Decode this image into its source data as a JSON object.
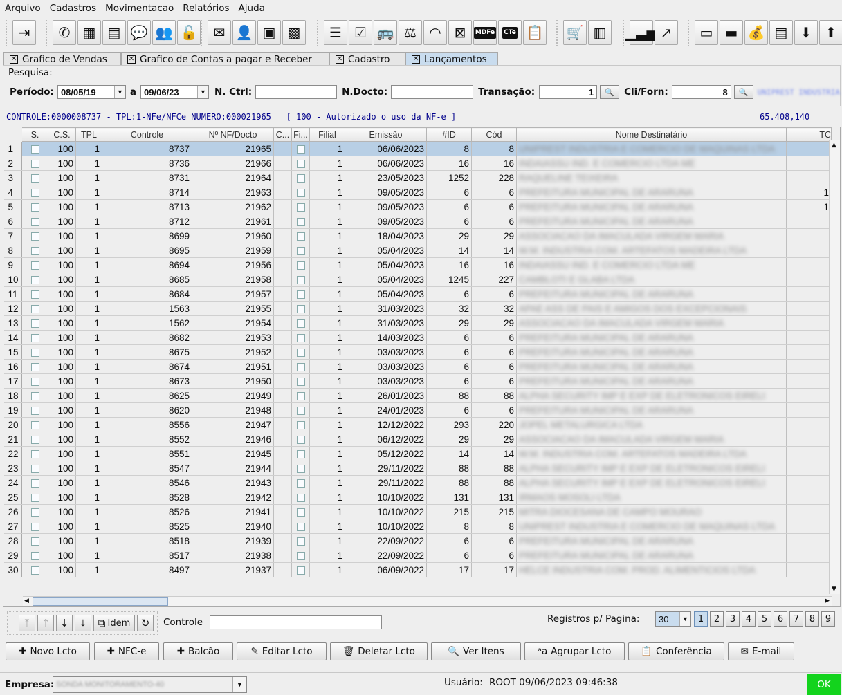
{
  "menu": [
    "Arquivo",
    "Cadastros",
    "Movimentacao",
    "Relatórios",
    "Ajuda"
  ],
  "toolbar_icons": {
    "g1": [
      "exit-icon"
    ],
    "g2": [
      "whatsapp-icon",
      "calculator-icon",
      "document-icon",
      "chat-icon",
      "users-group-icon",
      "lock-icon"
    ],
    "g3": [
      "mail-icon",
      "user-admin-icon",
      "package-icon",
      "calculator-dark-icon"
    ],
    "g4": [
      "list-icon",
      "checklist-icon",
      "bus-icon",
      "scale-icon",
      "rss-icon",
      "close-box-icon",
      "mdfe-icon",
      "cte-icon",
      "clipboard-check-icon"
    ],
    "g5": [
      "shopping-cart-icon",
      "cash-register-icon"
    ],
    "g6": [
      "bar-chart-icon",
      "trend-chart-icon"
    ],
    "g7": [
      "id-card-icon",
      "money-icon",
      "money-bag-icon",
      "invoice-icon",
      "box-down-icon",
      "box-up-icon"
    ]
  },
  "mdfe_label": "MDFe",
  "cte_label": "CTe",
  "tabs": [
    "Grafico de Vendas",
    "Grafico de Contas a pagar e Receber",
    "Cadastro",
    "Lançamentos"
  ],
  "search": {
    "title": "Pesquisa:",
    "periodo_label": "Período:",
    "date_from": "08/05/19",
    "a_label": "a",
    "date_to": "09/06/23",
    "nctrl_label": "N. Ctrl:",
    "nctrl_value": "",
    "ndocto_label": "N.Docto:",
    "ndocto_value": "",
    "transacao_label": "Transação:",
    "transacao_value": "1",
    "cliforn_label": "Cli/Forn:",
    "cliforn_value": "8",
    "cliforn_name": "UNIPREST INDUSTRIA"
  },
  "status_line": "CONTROLE:0000008737 - TPL:1-NFe/NFCe NUMERO:000021965   [ 100 - Autorizado o uso da NF-e ]",
  "status_total": "65.408,140",
  "columns": [
    "S.",
    "C.S.",
    "TPL",
    "Controle",
    "Nº NF/Docto",
    "C...",
    "Fi...",
    "Filial",
    "Emissão",
    "#ID",
    "Cód",
    "Nome Destinatário",
    "TC"
  ],
  "rows": [
    {
      "n": "1",
      "cs": "100",
      "tpl": "1",
      "ctrl": "8737",
      "nf": "21965",
      "filial": "1",
      "emissao": "06/06/2023",
      "id": "8",
      "cod": "8",
      "nome": "UNIPREST INDUSTRIA E COMERCIO DE MAQUINAS LTDA",
      "tc": ""
    },
    {
      "n": "2",
      "cs": "100",
      "tpl": "1",
      "ctrl": "8736",
      "nf": "21966",
      "filial": "1",
      "emissao": "06/06/2023",
      "id": "16",
      "cod": "16",
      "nome": "INDAIASSU IND. E COMERCIO LTDA ME",
      "tc": ""
    },
    {
      "n": "3",
      "cs": "100",
      "tpl": "1",
      "ctrl": "8731",
      "nf": "21964",
      "filial": "1",
      "emissao": "23/05/2023",
      "id": "1252",
      "cod": "228",
      "nome": "RAQUELINE TEIXEIRA",
      "tc": ""
    },
    {
      "n": "4",
      "cs": "100",
      "tpl": "1",
      "ctrl": "8714",
      "nf": "21963",
      "filial": "1",
      "emissao": "09/05/2023",
      "id": "6",
      "cod": "6",
      "nome": "PREFEITURA MUNICIPAL DE ARARUNA",
      "tc": "1"
    },
    {
      "n": "5",
      "cs": "100",
      "tpl": "1",
      "ctrl": "8713",
      "nf": "21962",
      "filial": "1",
      "emissao": "09/05/2023",
      "id": "6",
      "cod": "6",
      "nome": "PREFEITURA MUNICIPAL DE ARARUNA",
      "tc": "1"
    },
    {
      "n": "6",
      "cs": "100",
      "tpl": "1",
      "ctrl": "8712",
      "nf": "21961",
      "filial": "1",
      "emissao": "09/05/2023",
      "id": "6",
      "cod": "6",
      "nome": "PREFEITURA MUNICIPAL DE ARARUNA",
      "tc": ""
    },
    {
      "n": "7",
      "cs": "100",
      "tpl": "1",
      "ctrl": "8699",
      "nf": "21960",
      "filial": "1",
      "emissao": "18/04/2023",
      "id": "29",
      "cod": "29",
      "nome": "ASSOCIACAO DA IMACULADA VIRGEM MARIA",
      "tc": ""
    },
    {
      "n": "8",
      "cs": "100",
      "tpl": "1",
      "ctrl": "8695",
      "nf": "21959",
      "filial": "1",
      "emissao": "05/04/2023",
      "id": "14",
      "cod": "14",
      "nome": "W.M. INDUSTRIA COM. ARTEFATOS MADEIRA LTDA",
      "tc": ""
    },
    {
      "n": "9",
      "cs": "100",
      "tpl": "1",
      "ctrl": "8694",
      "nf": "21956",
      "filial": "1",
      "emissao": "05/04/2023",
      "id": "16",
      "cod": "16",
      "nome": "INDAIASSU IND. E COMERCIO LTDA ME",
      "tc": ""
    },
    {
      "n": "10",
      "cs": "100",
      "tpl": "1",
      "ctrl": "8685",
      "nf": "21958",
      "filial": "1",
      "emissao": "05/04/2023",
      "id": "1245",
      "cod": "227",
      "nome": "CAMBLOTI E GLABA LTDA",
      "tc": ""
    },
    {
      "n": "11",
      "cs": "100",
      "tpl": "1",
      "ctrl": "8684",
      "nf": "21957",
      "filial": "1",
      "emissao": "05/04/2023",
      "id": "6",
      "cod": "6",
      "nome": "PREFEITURA MUNICIPAL DE ARARUNA",
      "tc": ""
    },
    {
      "n": "12",
      "cs": "100",
      "tpl": "1",
      "ctrl": "1563",
      "nf": "21955",
      "filial": "1",
      "emissao": "31/03/2023",
      "id": "32",
      "cod": "32",
      "nome": "APAE ASS DE PAIS E AMIGOS DOS EXCEPCIONAIS",
      "tc": ""
    },
    {
      "n": "13",
      "cs": "100",
      "tpl": "1",
      "ctrl": "1562",
      "nf": "21954",
      "filial": "1",
      "emissao": "31/03/2023",
      "id": "29",
      "cod": "29",
      "nome": "ASSOCIACAO DA IMACULADA VIRGEM MARIA",
      "tc": ""
    },
    {
      "n": "14",
      "cs": "100",
      "tpl": "1",
      "ctrl": "8682",
      "nf": "21953",
      "filial": "1",
      "emissao": "14/03/2023",
      "id": "6",
      "cod": "6",
      "nome": "PREFEITURA MUNICIPAL DE ARARUNA",
      "tc": ""
    },
    {
      "n": "15",
      "cs": "100",
      "tpl": "1",
      "ctrl": "8675",
      "nf": "21952",
      "filial": "1",
      "emissao": "03/03/2023",
      "id": "6",
      "cod": "6",
      "nome": "PREFEITURA MUNICIPAL DE ARARUNA",
      "tc": ""
    },
    {
      "n": "16",
      "cs": "100",
      "tpl": "1",
      "ctrl": "8674",
      "nf": "21951",
      "filial": "1",
      "emissao": "03/03/2023",
      "id": "6",
      "cod": "6",
      "nome": "PREFEITURA MUNICIPAL DE ARARUNA",
      "tc": ""
    },
    {
      "n": "17",
      "cs": "100",
      "tpl": "1",
      "ctrl": "8673",
      "nf": "21950",
      "filial": "1",
      "emissao": "03/03/2023",
      "id": "6",
      "cod": "6",
      "nome": "PREFEITURA MUNICIPAL DE ARARUNA",
      "tc": ""
    },
    {
      "n": "18",
      "cs": "100",
      "tpl": "1",
      "ctrl": "8625",
      "nf": "21949",
      "filial": "1",
      "emissao": "26/01/2023",
      "id": "88",
      "cod": "88",
      "nome": "ALPHA SECURITY IMP E EXP DE ELETRONICOS EIRELI",
      "tc": ""
    },
    {
      "n": "19",
      "cs": "100",
      "tpl": "1",
      "ctrl": "8620",
      "nf": "21948",
      "filial": "1",
      "emissao": "24/01/2023",
      "id": "6",
      "cod": "6",
      "nome": "PREFEITURA MUNICIPAL DE ARARUNA",
      "tc": ""
    },
    {
      "n": "20",
      "cs": "100",
      "tpl": "1",
      "ctrl": "8556",
      "nf": "21947",
      "filial": "1",
      "emissao": "12/12/2022",
      "id": "293",
      "cod": "220",
      "nome": "JOPEL METALURGICA LTDA",
      "tc": ""
    },
    {
      "n": "21",
      "cs": "100",
      "tpl": "1",
      "ctrl": "8552",
      "nf": "21946",
      "filial": "1",
      "emissao": "06/12/2022",
      "id": "29",
      "cod": "29",
      "nome": "ASSOCIACAO DA IMACULADA VIRGEM MARIA",
      "tc": ""
    },
    {
      "n": "22",
      "cs": "100",
      "tpl": "1",
      "ctrl": "8551",
      "nf": "21945",
      "filial": "1",
      "emissao": "05/12/2022",
      "id": "14",
      "cod": "14",
      "nome": "W.M. INDUSTRIA COM. ARTEFATOS MADEIRA LTDA",
      "tc": ""
    },
    {
      "n": "23",
      "cs": "100",
      "tpl": "1",
      "ctrl": "8547",
      "nf": "21944",
      "filial": "1",
      "emissao": "29/11/2022",
      "id": "88",
      "cod": "88",
      "nome": "ALPHA SECURITY IMP E EXP DE ELETRONICOS EIRELI",
      "tc": ""
    },
    {
      "n": "24",
      "cs": "100",
      "tpl": "1",
      "ctrl": "8546",
      "nf": "21943",
      "filial": "1",
      "emissao": "29/11/2022",
      "id": "88",
      "cod": "88",
      "nome": "ALPHA SECURITY IMP E EXP DE ELETRONICOS EIRELI",
      "tc": ""
    },
    {
      "n": "25",
      "cs": "100",
      "tpl": "1",
      "ctrl": "8528",
      "nf": "21942",
      "filial": "1",
      "emissao": "10/10/2022",
      "id": "131",
      "cod": "131",
      "nome": "IRMAOS MOSOLI LTDA",
      "tc": ""
    },
    {
      "n": "26",
      "cs": "100",
      "tpl": "1",
      "ctrl": "8526",
      "nf": "21941",
      "filial": "1",
      "emissao": "10/10/2022",
      "id": "215",
      "cod": "215",
      "nome": "MITRA DIOCESANA DE CAMPO MOURAO",
      "tc": ""
    },
    {
      "n": "27",
      "cs": "100",
      "tpl": "1",
      "ctrl": "8525",
      "nf": "21940",
      "filial": "1",
      "emissao": "10/10/2022",
      "id": "8",
      "cod": "8",
      "nome": "UNIPREST INDUSTRIA E COMERCIO DE MAQUINAS LTDA",
      "tc": ""
    },
    {
      "n": "28",
      "cs": "100",
      "tpl": "1",
      "ctrl": "8518",
      "nf": "21939",
      "filial": "1",
      "emissao": "22/09/2022",
      "id": "6",
      "cod": "6",
      "nome": "PREFEITURA MUNICIPAL DE ARARUNA",
      "tc": ""
    },
    {
      "n": "29",
      "cs": "100",
      "tpl": "1",
      "ctrl": "8517",
      "nf": "21938",
      "filial": "1",
      "emissao": "22/09/2022",
      "id": "6",
      "cod": "6",
      "nome": "PREFEITURA MUNICIPAL DE ARARUNA",
      "tc": ""
    },
    {
      "n": "30",
      "cs": "100",
      "tpl": "1",
      "ctrl": "8497",
      "nf": "21937",
      "filial": "1",
      "emissao": "06/09/2022",
      "id": "17",
      "cod": "17",
      "nome": "HELCE INDUSTRIA COM. PROD. ALIMENTICIOS LTDA",
      "tc": ""
    }
  ],
  "pager": {
    "idem_label": "Idem",
    "controle_label": "Controle",
    "controle_value": "",
    "registros_label": "Registros p/ Pagina:",
    "registros_value": "30",
    "pages": [
      "1",
      "2",
      "3",
      "4",
      "5",
      "6",
      "7",
      "8",
      "9"
    ]
  },
  "actions": [
    {
      "label": "Novo Lcto",
      "icon": "plus-icon",
      "glyph": "✚"
    },
    {
      "label": "NFC-e",
      "icon": "plus-icon",
      "glyph": "✚"
    },
    {
      "label": "Balcão",
      "icon": "plus-icon",
      "glyph": "✚"
    },
    {
      "label": "Editar Lcto",
      "icon": "pencil-icon",
      "glyph": "✎"
    },
    {
      "label": "Deletar Lcto",
      "icon": "trash-icon",
      "glyph": "🗑"
    },
    {
      "label": "Ver Itens",
      "icon": "search-doc-icon",
      "glyph": "🔍"
    },
    {
      "label": "Agrupar Lcto",
      "icon": "group-text-icon",
      "glyph": "ᵃa"
    },
    {
      "label": "Conferência",
      "icon": "clipboard-check-icon",
      "glyph": "📋"
    },
    {
      "label": "E-mail",
      "icon": "mail-send-icon",
      "glyph": "✉"
    }
  ],
  "footer": {
    "empresa_label": "Empresa:",
    "empresa_value": "SONDA MONITORAMENTO-40",
    "usuario_label": "Usuário:",
    "usuario_value": "ROOT 09/06/2023 09:46:38",
    "ok_label": "OK"
  },
  "colors": {
    "selected_row": "#b8cfe5",
    "active_tab": "#c9dcee",
    "ok_button": "#13d31d",
    "status_text": "#00008b"
  }
}
